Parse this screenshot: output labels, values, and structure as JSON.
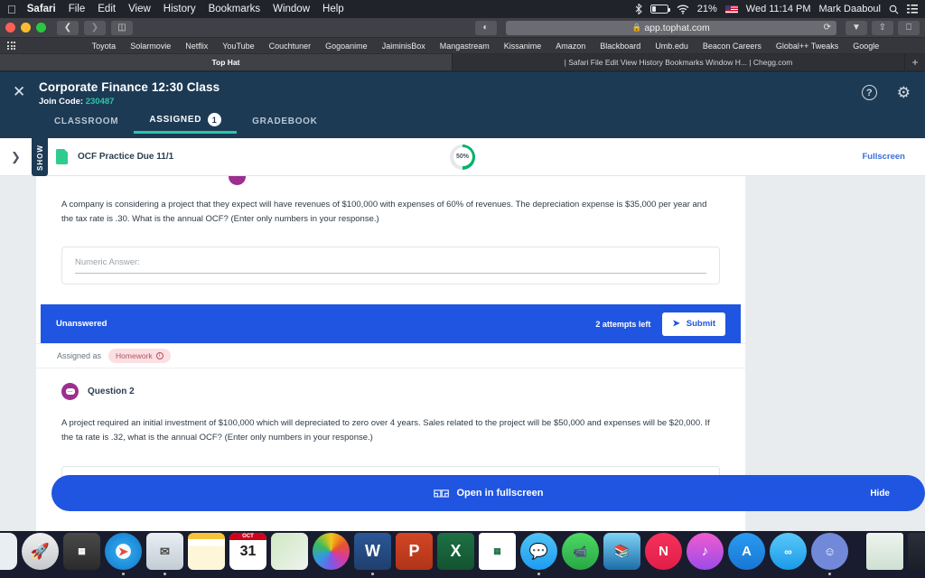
{
  "menubar": {
    "apple_icon": "apple-icon",
    "items": [
      {
        "label": "Safari",
        "bold": true
      },
      {
        "label": "File",
        "bold": false
      },
      {
        "label": "Edit",
        "bold": false
      },
      {
        "label": "View",
        "bold": false
      },
      {
        "label": "History",
        "bold": false
      },
      {
        "label": "Bookmarks",
        "bold": false
      },
      {
        "label": "Window",
        "bold": false
      },
      {
        "label": "Help",
        "bold": false
      }
    ],
    "status": {
      "bluetooth_icon": "bluetooth-icon",
      "battery_icon": "battery-icon",
      "wifi_icon": "wifi-icon",
      "battery_percent": "21%",
      "flag_icon": "us-flag-icon",
      "datetime": "Wed 11:14 PM",
      "user": "Mark Daaboul",
      "search_icon": "search-icon",
      "control_center_icon": "control-center-icon"
    }
  },
  "browser": {
    "back_icon": "chevron-left-icon",
    "forward_icon": "chevron-right-icon",
    "sidebar_icon": "sidebar-icon",
    "reader_icon": "reader-view-icon",
    "url": "app.tophat.com",
    "lock_icon": "lock-icon",
    "reload_icon": "reload-icon",
    "downloads_icon": "downloads-icon",
    "share_icon": "share-icon",
    "tab_overview_icon": "tab-overview-icon",
    "apps_grid_icon": "apps-grid-icon",
    "bookmarks": [
      "Toyota",
      "Solarmovie",
      "Netflix",
      "YouTube",
      "Couchtuner",
      "Gogoanime",
      "JaiminisBox",
      "Mangastream",
      "Kissanime",
      "Amazon",
      "Blackboard",
      "Umb.edu",
      "Beacon Careers",
      "Global++ Tweaks",
      "Google"
    ],
    "tabs": [
      {
        "title": "Top Hat",
        "active": true
      },
      {
        "title": "| Safari File Edit View History Bookmarks Window H... | Chegg.com",
        "active": false
      }
    ],
    "new_tab_label": "+"
  },
  "app": {
    "close_icon": "close-icon",
    "course_title": "Corporate Finance 12:30 Class",
    "join_code_label": "Join Code:",
    "join_code_value": "230487",
    "help_icon": "help-icon",
    "settings_icon": "gear-icon",
    "tabs": [
      {
        "label": "CLASSROOM",
        "active": false,
        "badge": null
      },
      {
        "label": "ASSIGNED",
        "active": true,
        "badge": "1"
      },
      {
        "label": "GRADEBOOK",
        "active": false,
        "badge": null
      }
    ],
    "subbar": {
      "expand_icon": "chevron-right-icon",
      "show_label": "SHOW",
      "document_icon": "document-icon",
      "document_title": "OCF Practice Due 11/1",
      "progress_percent": "50%",
      "fullscreen_link": "Fullscreen"
    },
    "question1": {
      "text": "A company is considering a project that they expect will have revenues of $100,000 with expenses of 60% of revenues.  The depreciation expense is $35,000 per year and the tax rate is .30.  What is the annual OCF?  (Enter only numbers in your response.)",
      "answer_placeholder": "Numeric Answer:",
      "answer_value": "",
      "status": "Unanswered",
      "attempts": "2 attempts left",
      "submit_label": "Submit",
      "submit_icon": "paper-plane-icon"
    },
    "question2": {
      "assigned_as_label": "Assigned as",
      "assigned_as_value": "Homework",
      "info_icon": "info-icon",
      "avatar_icon": "question-avatar-icon",
      "label": "Question 2",
      "text": "A project required an initial investment of $100,000 which will depreciated to zero over 4 years.    Sales related to the project will be $50,000 and expenses will be $20,000.  If the ta rate is .32, what is the annual OCF?  (Enter only numbers in your response.)"
    },
    "fullscreen_bar": {
      "expand_icon": "expand-icon",
      "label": "Open in fullscreen",
      "hide_label": "Hide"
    },
    "colors": {
      "header_bg": "#1d3a55",
      "accent_teal": "#29c7a5",
      "primary_blue": "#1f55e0",
      "link_blue": "#3a6fd8",
      "avatar_purple": "#9c2f8f",
      "homework_pink": "#fbdfe2",
      "progress_green": "#00b26a"
    }
  },
  "dock": {
    "items": [
      {
        "name": "messages",
        "glyph": "",
        "running": false
      },
      {
        "name": "finder",
        "glyph": "",
        "running": true
      },
      {
        "name": "launchpad",
        "glyph": "▲",
        "running": false
      },
      {
        "name": "calculator",
        "glyph": "",
        "running": false
      },
      {
        "name": "safari",
        "glyph": "",
        "running": true
      },
      {
        "name": "mail",
        "glyph": "",
        "running": true
      },
      {
        "name": "notes",
        "glyph": "",
        "running": false
      },
      {
        "name": "calendar",
        "glyph": "",
        "running": false,
        "month": "OCT",
        "day": "31"
      },
      {
        "name": "maps",
        "glyph": "",
        "running": false
      },
      {
        "name": "photos",
        "glyph": "",
        "running": false
      },
      {
        "name": "word",
        "glyph": "W",
        "running": true
      },
      {
        "name": "powerpoint",
        "glyph": "P",
        "running": false
      },
      {
        "name": "excel",
        "glyph": "X",
        "running": false
      },
      {
        "name": "excel-sheet",
        "glyph": "▒",
        "running": false
      },
      {
        "name": "messages-2",
        "glyph": "",
        "running": true
      },
      {
        "name": "facetime",
        "glyph": "",
        "running": false
      },
      {
        "name": "books",
        "glyph": "",
        "running": false
      },
      {
        "name": "news",
        "glyph": "",
        "running": false
      },
      {
        "name": "itunes",
        "glyph": "♪",
        "running": false
      },
      {
        "name": "app-store",
        "glyph": "A",
        "running": false
      },
      {
        "name": "shield-app",
        "glyph": "∞",
        "running": false
      },
      {
        "name": "discord",
        "glyph": "",
        "running": true
      }
    ],
    "minimized": [
      {
        "name": "excel-window"
      },
      {
        "name": "discord-window"
      }
    ],
    "trash": {
      "name": "trash"
    }
  }
}
